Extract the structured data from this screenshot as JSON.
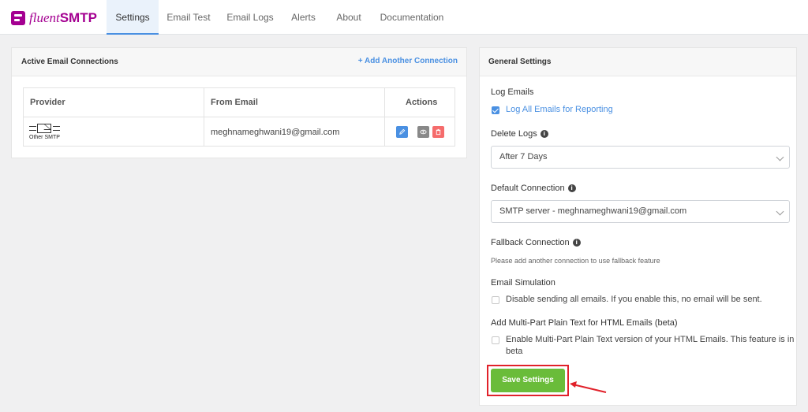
{
  "brand": {
    "fluent": "fluent",
    "smtp": "SMTP"
  },
  "tabs": [
    {
      "label": "Settings",
      "active": true
    },
    {
      "label": "Email Test"
    },
    {
      "label": "Email Logs"
    },
    {
      "label": "Alerts"
    },
    {
      "label": "About"
    },
    {
      "label": "Documentation"
    }
  ],
  "connections": {
    "title": "Active Email Connections",
    "add_label": "+ Add Another Connection",
    "headers": {
      "provider": "Provider",
      "from_email": "From Email",
      "actions": "Actions"
    },
    "rows": [
      {
        "provider": "Other SMTP",
        "from_email": "meghnameghwani19@gmail.com"
      }
    ]
  },
  "general": {
    "title": "General Settings",
    "log_emails": {
      "label": "Log Emails",
      "checkbox_label": "Log All Emails for Reporting",
      "checked": true
    },
    "delete_logs": {
      "label": "Delete Logs",
      "value": "After 7 Days"
    },
    "default_connection": {
      "label": "Default Connection",
      "value": "SMTP server - meghnameghwani19@gmail.com"
    },
    "fallback": {
      "label": "Fallback Connection",
      "hint": "Please add another connection to use fallback feature"
    },
    "simulation": {
      "label": "Email Simulation",
      "checkbox_label": "Disable sending all emails. If you enable this, no email will be sent.",
      "checked": false
    },
    "multipart": {
      "label": "Add Multi-Part Plain Text for HTML Emails (beta)",
      "checkbox_label_1": "Enable Multi-Part Plain Text version of your HTML Emails. This feature is in",
      "checkbox_label_2": "beta",
      "checked": false
    },
    "save_label": "Save Settings"
  },
  "colors": {
    "brand": "#a40091",
    "accent": "#4a90e2",
    "save": "#6abc3a",
    "highlight": "#e1212a"
  }
}
